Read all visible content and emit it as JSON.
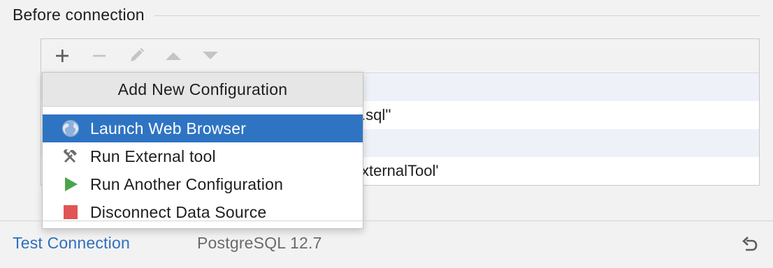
{
  "section": {
    "title": "Before connection"
  },
  "toolbar": {
    "buttons": [
      {
        "name": "add-icon"
      },
      {
        "name": "remove-icon"
      },
      {
        "name": "edit-icon"
      },
      {
        "name": "move-up-icon"
      },
      {
        "name": "move-down-icon"
      }
    ]
  },
  "tasks": {
    "rows": [
      "",
      ".sql''",
      "",
      "xternalTool'"
    ]
  },
  "popup": {
    "title": "Add New Configuration",
    "items": [
      {
        "label": "Launch Web Browser",
        "icon": "globe-icon",
        "selected": true
      },
      {
        "label": "Run External tool",
        "icon": "tools-icon"
      },
      {
        "label": "Run Another Configuration",
        "icon": "run-icon"
      },
      {
        "label": "Disconnect Data Source",
        "icon": "stop-icon"
      }
    ]
  },
  "footer": {
    "test_connection": "Test Connection",
    "driver": "PostgreSQL 12.7"
  },
  "colors": {
    "selection": "#2f74c3",
    "link": "#2f6fbd",
    "run_green": "#4aa54a",
    "stop_red": "#e05555"
  }
}
